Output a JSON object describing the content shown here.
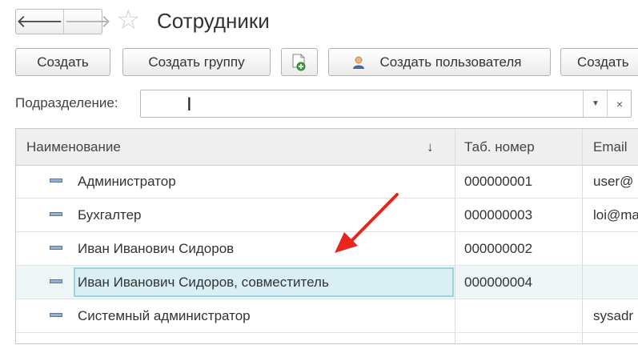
{
  "header": {
    "title": "Сотрудники",
    "back_icon": "🡐",
    "forward_icon": "🡒",
    "star_icon": "☆"
  },
  "toolbar": {
    "create_label": "Создать",
    "create_group_label": "Создать группу",
    "create_user_label": "Создать пользователя",
    "create_cut_label": "Создать"
  },
  "filter": {
    "label": "Подразделение:",
    "value": "",
    "dropdown_icon": "▼",
    "clear_icon": "×"
  },
  "table": {
    "columns": [
      "Наименование",
      "Таб. номер",
      "Email"
    ],
    "sort_icon": "↓",
    "rows": [
      {
        "name": "Администратор",
        "tab": "000000001",
        "email": "user@"
      },
      {
        "name": "Бухгалтер",
        "tab": "000000003",
        "email": "loi@ma"
      },
      {
        "name": "Иван Иванович Сидоров",
        "tab": "000000002",
        "email": ""
      },
      {
        "name": "Иван Иванович Сидоров, совместитель",
        "tab": "000000004",
        "email": ""
      },
      {
        "name": "Системный администратор",
        "tab": "",
        "email": "sysadr"
      }
    ],
    "selected_row": 3
  },
  "colors": {
    "arrow": "#e8261e",
    "selection": "#d9eff3",
    "row_icon": "#8fb2d6"
  }
}
